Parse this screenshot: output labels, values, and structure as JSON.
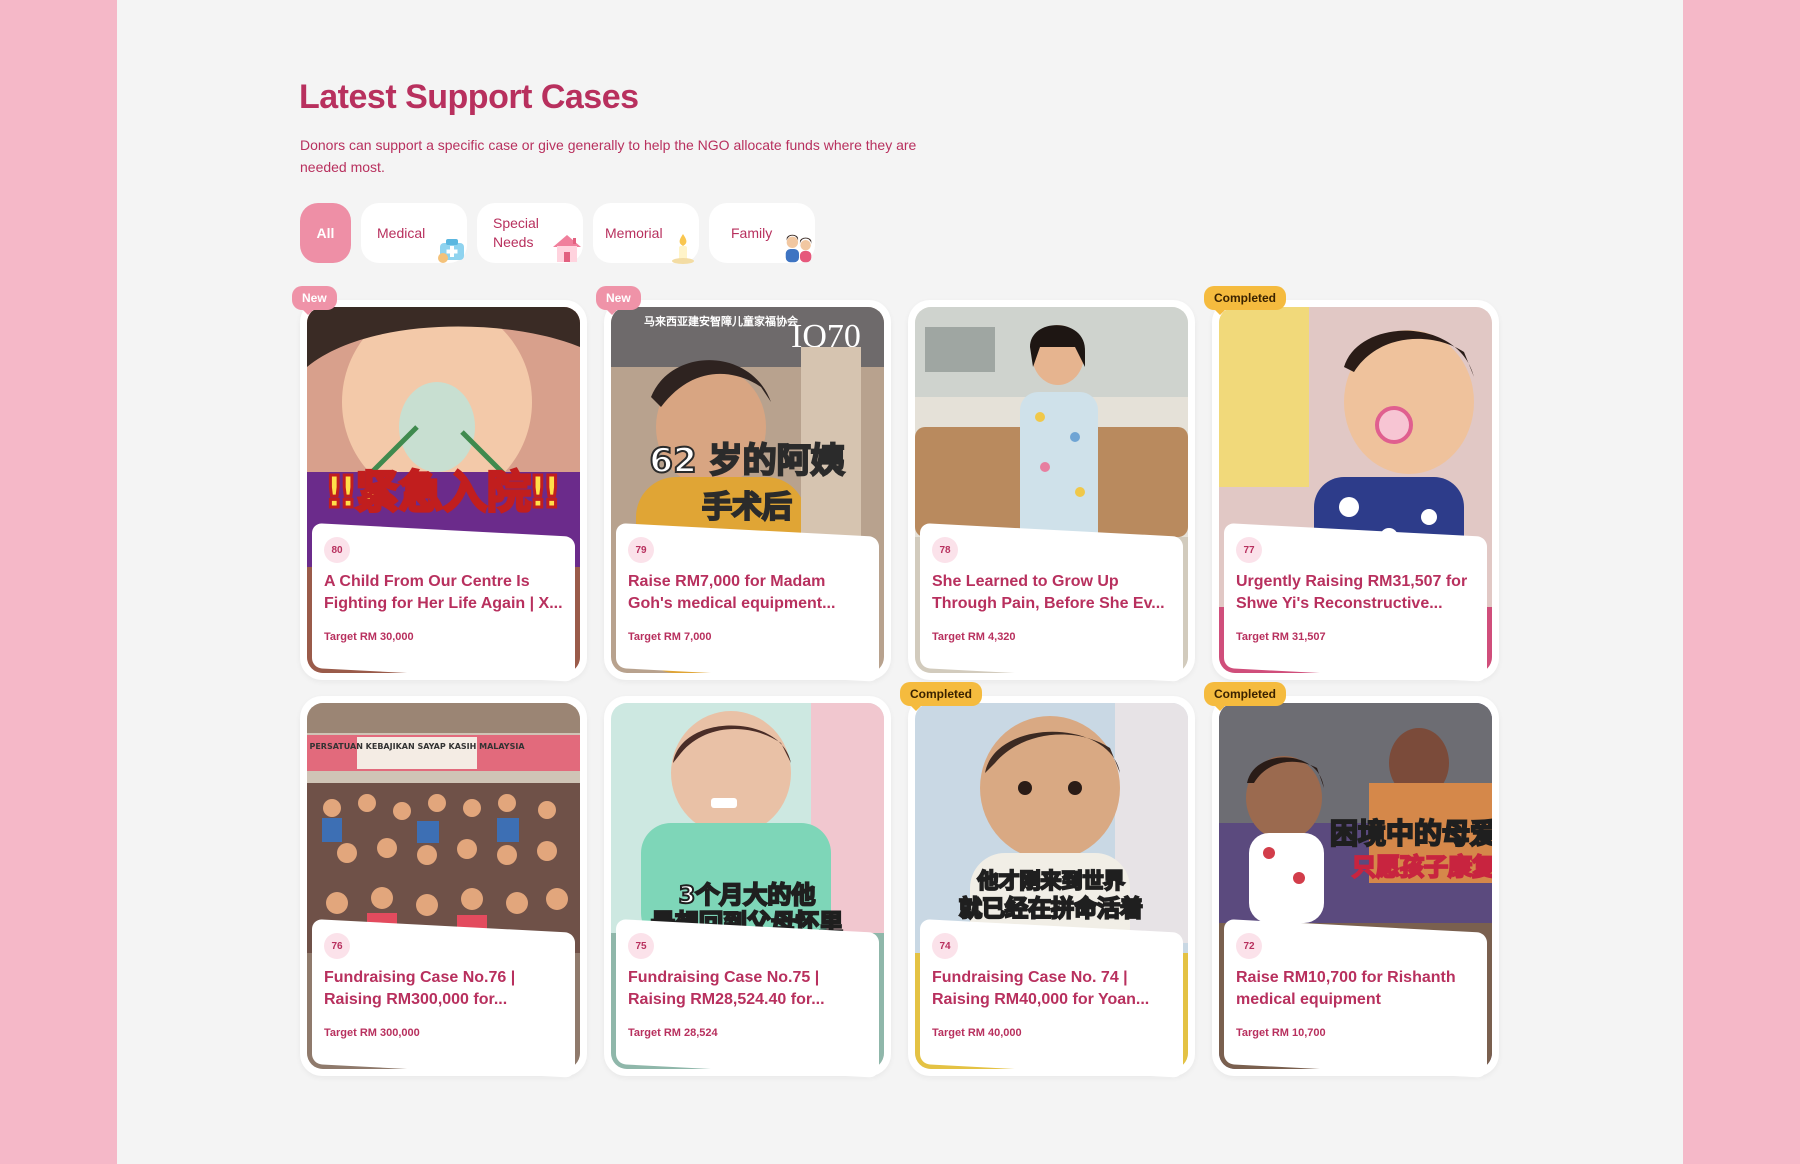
{
  "section": {
    "heading": "Latest Support Cases",
    "description": "Donors can support a specific case or give generally to help the NGO allocate funds where they are needed most."
  },
  "filters": [
    {
      "label": "All",
      "active": true,
      "icon": ""
    },
    {
      "label": "Medical",
      "active": false,
      "icon": "medical-kit-icon"
    },
    {
      "label": "Special Needs",
      "active": false,
      "icon": "house-icon"
    },
    {
      "label": "Memorial",
      "active": false,
      "icon": "candle-icon"
    },
    {
      "label": "Family",
      "active": false,
      "icon": "family-icon"
    }
  ],
  "cases": [
    {
      "number": "80",
      "badge": "New",
      "title": "A Child From Our Centre Is Fighting for Her Life Again | X...",
      "target": "Target RM 30,000",
      "image_text": [
        "‼紧急入院‼"
      ]
    },
    {
      "number": "79",
      "badge": "New",
      "title": "Raise RM7,000 for Madam Goh's medical equipment...",
      "target": "Target RM 7,000",
      "image_text": [
        "62 岁的阿姨",
        "手术后",
        "马来西亚建安智障儿童家福协会",
        "IQ70"
      ]
    },
    {
      "number": "78",
      "badge": "",
      "title": "She Learned to Grow Up Through Pain, Before She Ev...",
      "target": "Target RM 4,320",
      "image_text": []
    },
    {
      "number": "77",
      "badge": "Completed",
      "title": "Urgently Raising RM31,507 for Shwe Yi's Reconstructive...",
      "target": "Target RM 31,507",
      "image_text": []
    },
    {
      "number": "76",
      "badge": "",
      "title": "Fundraising Case No.76 | Raising RM300,000 for...",
      "target": "Target RM 300,000",
      "image_text": [
        "PERSATUAN KEBAJIKAN SAYAP KASIH MALAYSIA"
      ]
    },
    {
      "number": "75",
      "badge": "",
      "title": "Fundraising Case No.75 | Raising RM28,524.40 for...",
      "target": "Target RM 28,524",
      "image_text": [
        "3个月大的他",
        "最想回到父母怀里"
      ]
    },
    {
      "number": "74",
      "badge": "Completed",
      "title": "Fundraising Case No. 74 | Raising RM40,000 for Yoan...",
      "target": "Target RM 40,000",
      "image_text": [
        "他才刚来到世界",
        "就已经在拼命活着"
      ]
    },
    {
      "number": "72",
      "badge": "Completed",
      "title": "Raise RM10,700 for Rishanth medical equipment",
      "target": "Target RM 10,700",
      "image_text": [
        "困境中的母爱",
        "只愿孩子康复"
      ]
    }
  ],
  "colors": {
    "page_bg": "#f5b8c8",
    "panel_bg": "#f4f4f4",
    "accent": "#b8305e",
    "chip_active": "#ee8fa6",
    "badge_new": "#ef93a8",
    "badge_completed": "#f5bb3e"
  }
}
